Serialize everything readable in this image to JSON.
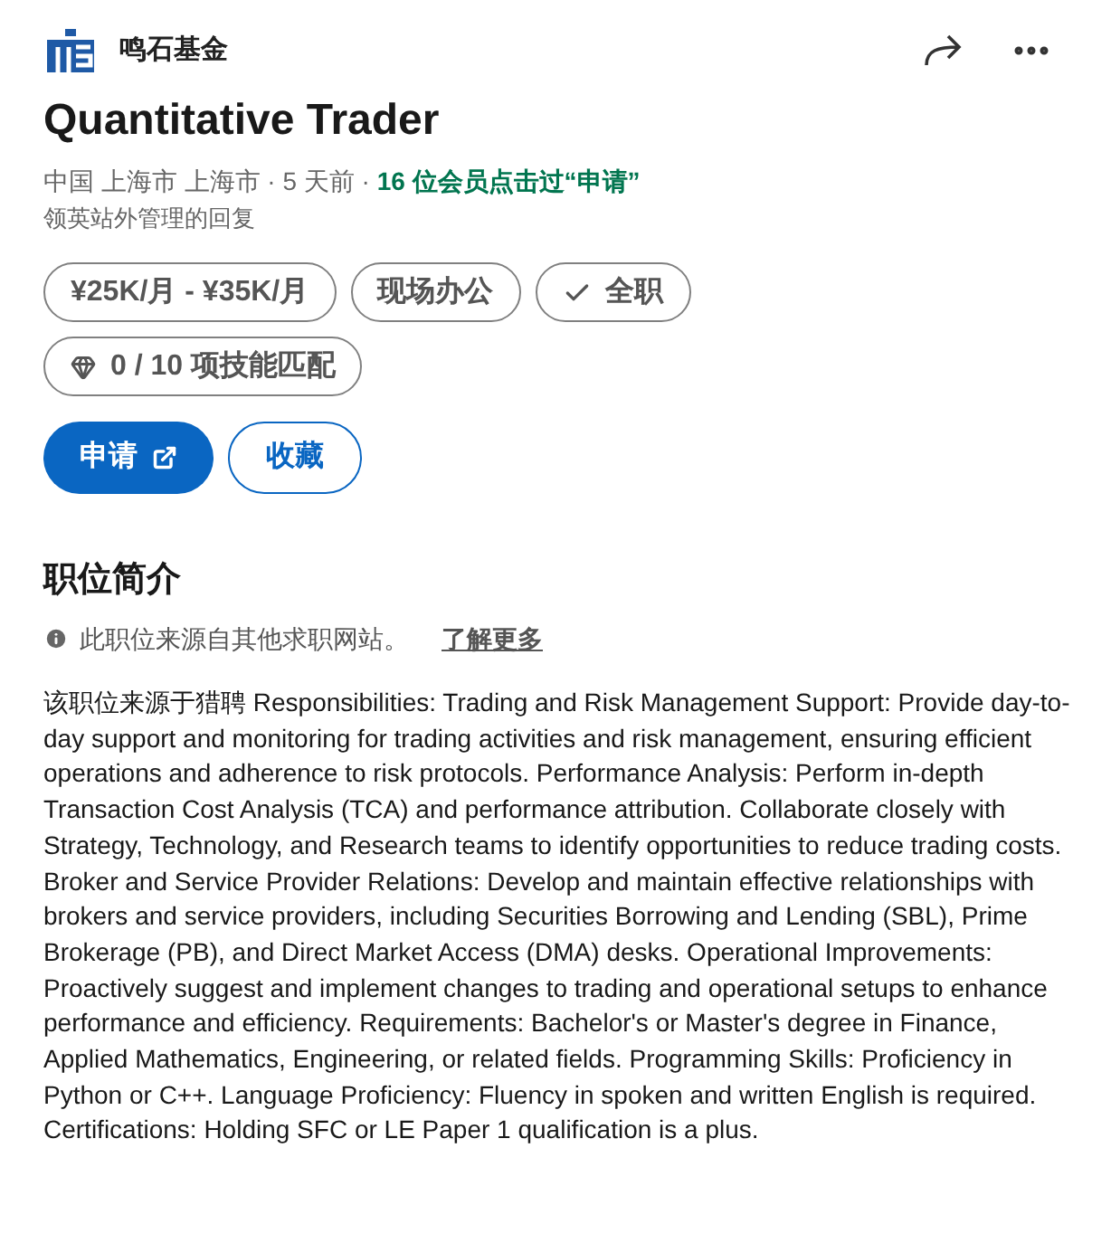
{
  "company": {
    "name": "鸣石基金"
  },
  "job": {
    "title": "Quantitative Trader",
    "meta": "中国 上海市 上海市 · 5 天前 · ",
    "applicants": "16 位会员点击过“申请”",
    "note": "领英站外管理的回复"
  },
  "pills": [
    {
      "kind": "plain",
      "label": "¥25K/月 - ¥35K/月"
    },
    {
      "kind": "plain",
      "label": "现场办公"
    },
    {
      "kind": "check",
      "label": "全职"
    },
    {
      "kind": "skill",
      "label": "0 / 10 项技能匹配"
    }
  ],
  "actions": [
    {
      "kind": "primary",
      "label": "申请"
    },
    {
      "kind": "secondary",
      "label": "收藏"
    }
  ],
  "section": {
    "title": "职位简介",
    "source_note": "此职位来源自其他求职网站。",
    "learn_more": "了解更多",
    "description": "该职位来源于猎聘 Responsibilities: Trading and Risk Management Support: Provide day-to-day support and monitoring for trading activities and risk management, ensuring efficient operations and adherence to risk protocols. Performance Analysis: Perform in-depth Transaction Cost Analysis (TCA) and performance attribution. Collaborate closely with Strategy, Technology, and Research teams to identify opportunities to reduce trading costs. Broker and Service Provider Relations: Develop and maintain effective relationships with brokers and service providers, including Securities Borrowing and Lending (SBL), Prime Brokerage (PB), and Direct Market Access (DMA) desks. Operational Improvements: Proactively suggest and implement changes to trading and operational setups to enhance performance and efficiency. Requirements: Bachelor's or Master's degree in Finance, Applied Mathematics, Engineering, or related fields. Programming Skills: Proficiency in Python or C++. Language Proficiency: Fluency in spoken and written English is required. Certifications: Holding SFC or LE Paper 1 qualification is a plus."
  }
}
